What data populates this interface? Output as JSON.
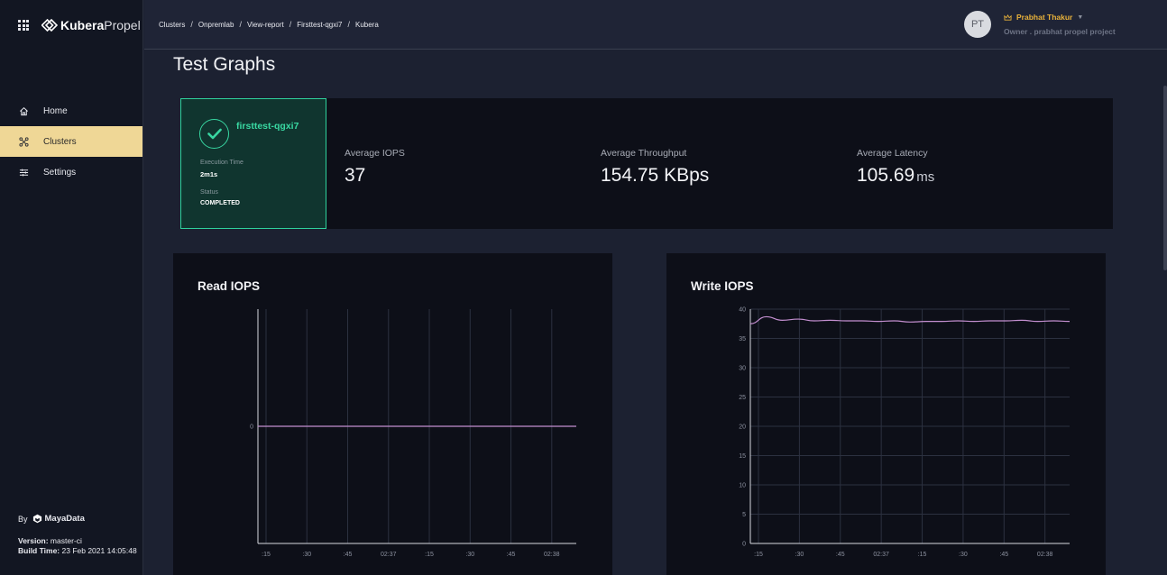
{
  "app": {
    "brand_bold": "Kubera",
    "brand_light": "Propel"
  },
  "sidebar": {
    "items": [
      {
        "label": "Home",
        "icon": "home-icon",
        "active": false
      },
      {
        "label": "Clusters",
        "icon": "clusters-icon",
        "active": true
      },
      {
        "label": "Settings",
        "icon": "settings-icon",
        "active": false
      }
    ],
    "footer": {
      "by": "By",
      "company": "MayaData",
      "version_label": "Version:",
      "version_value": "master-ci",
      "build_label": "Build Time:",
      "build_value": "23 Feb 2021 14:05:48"
    }
  },
  "header": {
    "breadcrumb": [
      "Clusters",
      "Onpremlab",
      "View-report",
      "Firsttest-qgxi7",
      "Kubera"
    ],
    "separator": "/",
    "avatar_initials": "PT",
    "user_name": "Prabhat Thakur",
    "user_role": "Owner . prabhat propel project"
  },
  "page": {
    "title": "Test Graphs"
  },
  "summary": {
    "test_name": "firsttest-qgxi7",
    "execution_label": "Execution Time",
    "execution_value": "2m1s",
    "status_label": "Status",
    "status_value": "COMPLETED",
    "metrics": [
      {
        "label": "Average IOPS",
        "value": "37",
        "unit": ""
      },
      {
        "label": "Average Throughput",
        "value": "154.75 KBps",
        "unit": ""
      },
      {
        "label": "Average Latency",
        "value": "105.69",
        "unit": "ms"
      }
    ]
  },
  "colors": {
    "accent": "#efd796",
    "success": "#39d8a2",
    "series": "#c48fd0",
    "user": "#e8b13a"
  },
  "chart_data": [
    {
      "type": "line",
      "title": "Read IOPS",
      "x": [
        ":15",
        ":30",
        ":45",
        "02:37",
        ":15",
        ":30",
        ":45",
        "02:38"
      ],
      "yticks": [
        "0"
      ],
      "series": [
        {
          "values": [
            0,
            0,
            0,
            0,
            0,
            0,
            0,
            0
          ]
        }
      ]
    },
    {
      "type": "line",
      "title": "Write IOPS",
      "x": [
        ":15",
        ":30",
        ":45",
        "02:37",
        ":15",
        ":30",
        ":45",
        "02:38"
      ],
      "ylim": [
        0,
        40
      ],
      "yticks": [
        "0",
        "5",
        "10",
        "15",
        "20",
        "25",
        "30",
        "35",
        "40"
      ],
      "series": [
        {
          "values": [
            37.5,
            38.7,
            38.1,
            38.3,
            38.0,
            38.1,
            38.0,
            38.0,
            37.9,
            38.0,
            37.8,
            37.9,
            37.9,
            38.0,
            37.9,
            38.0,
            38.0,
            38.1,
            37.9,
            38.0,
            37.9
          ]
        }
      ]
    }
  ]
}
